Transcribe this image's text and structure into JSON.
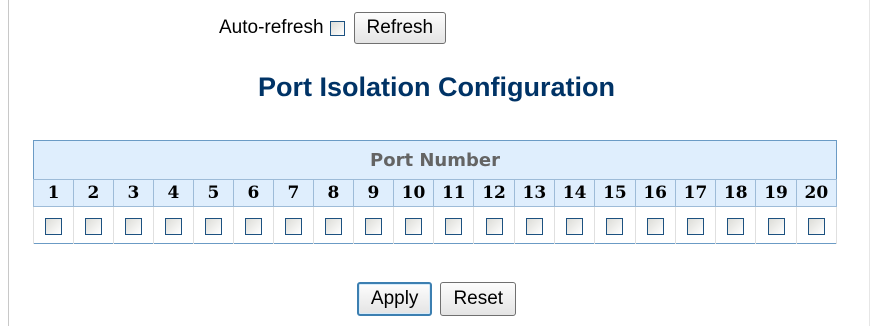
{
  "toolbar": {
    "auto_refresh_label": "Auto-refresh",
    "auto_refresh_checked": false,
    "refresh_label": "Refresh"
  },
  "page": {
    "title": "Port Isolation Configuration"
  },
  "table": {
    "group_header": "Port Number",
    "ports": [
      "1",
      "2",
      "3",
      "4",
      "5",
      "6",
      "7",
      "8",
      "9",
      "10",
      "11",
      "12",
      "13",
      "14",
      "15",
      "16",
      "17",
      "18",
      "19",
      "20"
    ],
    "checked": [
      false,
      false,
      false,
      false,
      false,
      false,
      false,
      false,
      false,
      false,
      false,
      false,
      false,
      false,
      false,
      false,
      false,
      false,
      false,
      false
    ]
  },
  "actions": {
    "apply_label": "Apply",
    "reset_label": "Reset"
  },
  "colors": {
    "title": "#003366",
    "header_bg": "#dfeefd",
    "header_text": "#646464",
    "table_border": "#6b9bc5"
  }
}
